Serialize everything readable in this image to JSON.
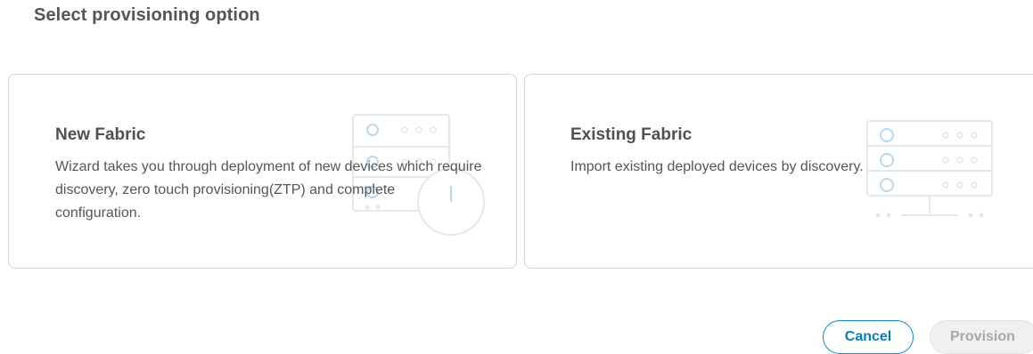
{
  "page": {
    "title": "Select provisioning option"
  },
  "options": [
    {
      "title": "New Fabric",
      "description": "Wizard takes you through deployment of new devices which require discovery, zero touch provisioning(ZTP) and complete configuration.",
      "illustration": "server-rack-power-icon"
    },
    {
      "title": "Existing Fabric",
      "description": "Import existing deployed devices by discovery.",
      "illustration": "server-rack-network-icon"
    }
  ],
  "actions": {
    "cancel_label": "Cancel",
    "provision_label": "Provision",
    "provision_enabled": false
  },
  "colors": {
    "accent": "#0a8ad0",
    "card_border": "#d6d6d6",
    "illustration_stroke": "#dfe6ee",
    "illustration_dot": "#b8d8f2",
    "disabled_bg": "#f0f0f0",
    "disabled_text": "#a8a8a8"
  }
}
